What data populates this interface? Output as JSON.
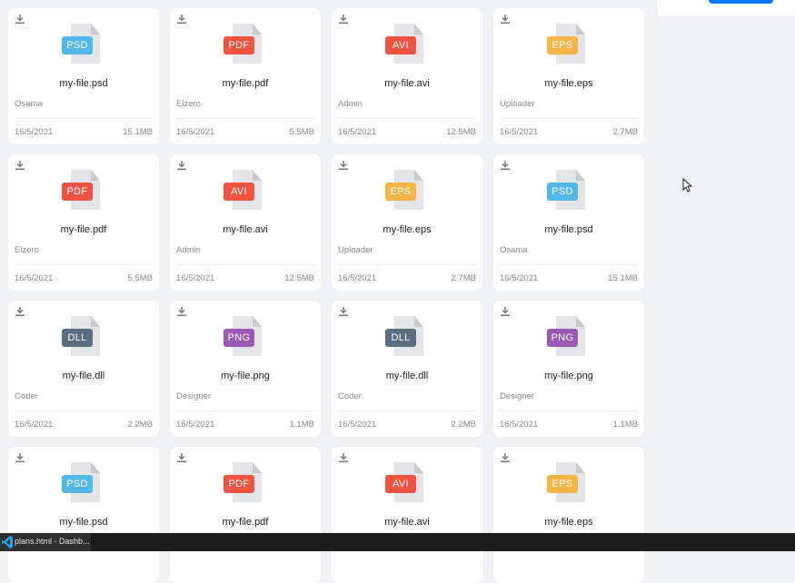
{
  "files": [
    {
      "type": "PSD",
      "color": "#53b7e8",
      "name": "my-file.psd",
      "uploader": "Osama",
      "date": "16/5/2021",
      "size": "15.1MB"
    },
    {
      "type": "PDF",
      "color": "#f0533f",
      "name": "my-file.pdf",
      "uploader": "Elzero",
      "date": "16/5/2021",
      "size": "5.5MB"
    },
    {
      "type": "AVI",
      "color": "#f0533f",
      "name": "my-file.avi",
      "uploader": "Admin",
      "date": "16/5/2021",
      "size": "12.5MB"
    },
    {
      "type": "EPS",
      "color": "#f5b547",
      "name": "my-file.eps",
      "uploader": "Uploader",
      "date": "16/5/2021",
      "size": "2.7MB"
    },
    {
      "type": "PDF",
      "color": "#f0533f",
      "name": "my-file.pdf",
      "uploader": "Elzero",
      "date": "16/5/2021",
      "size": "5.5MB"
    },
    {
      "type": "AVI",
      "color": "#f0533f",
      "name": "my-file.avi",
      "uploader": "Admin",
      "date": "16/5/2021",
      "size": "12.5MB"
    },
    {
      "type": "EPS",
      "color": "#f5b547",
      "name": "my-file.eps",
      "uploader": "Uploader",
      "date": "16/5/2021",
      "size": "2.7MB"
    },
    {
      "type": "PSD",
      "color": "#53b7e8",
      "name": "my-file.psd",
      "uploader": "Osama",
      "date": "16/5/2021",
      "size": "15.1MB"
    },
    {
      "type": "DLL",
      "color": "#5b6d80",
      "name": "my-file.dll",
      "uploader": "Coder",
      "date": "16/5/2021",
      "size": "2.2MB"
    },
    {
      "type": "PNG",
      "color": "#9b59b6",
      "name": "my-file.png",
      "uploader": "Designer",
      "date": "16/5/2021",
      "size": "1.1MB"
    },
    {
      "type": "DLL",
      "color": "#5b6d80",
      "name": "my-file.dll",
      "uploader": "Coder",
      "date": "16/5/2021",
      "size": "2.2MB"
    },
    {
      "type": "PNG",
      "color": "#9b59b6",
      "name": "my-file.png",
      "uploader": "Designer",
      "date": "16/5/2021",
      "size": "1.1MB"
    },
    {
      "type": "PSD",
      "color": "#53b7e8",
      "name": "my-file.psd"
    },
    {
      "type": "PDF",
      "color": "#f0533f",
      "name": "my-file.pdf"
    },
    {
      "type": "AVI",
      "color": "#f0533f",
      "name": "my-file.avi"
    },
    {
      "type": "EPS",
      "color": "#f5b547",
      "name": "my-file.eps"
    }
  ],
  "taskbar": {
    "app_label": "plans.html - Dashb...",
    "app_icon": "vscode-icon"
  },
  "icons": {
    "download": "download-icon",
    "file": "file-icon",
    "cursor": "mouse-pointer-icon"
  },
  "colors": {
    "page_background": "#f1f2f6",
    "card_background": "#ffffff",
    "accent_button": "#0075ff"
  }
}
